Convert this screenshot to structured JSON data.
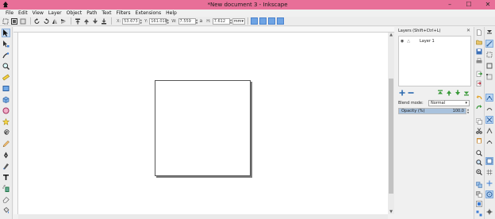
{
  "window": {
    "title": "*New document 3 - Inkscape",
    "controls": {
      "minimize": "–",
      "maximize": "☐",
      "close": "✕"
    },
    "title_bar_color": "#e86f98"
  },
  "menu": [
    "File",
    "Edit",
    "View",
    "Layer",
    "Object",
    "Path",
    "Text",
    "Filters",
    "Extensions",
    "Help"
  ],
  "selector_toolbar": {
    "x_label": "X:",
    "x_value": "53.673",
    "y_label": "Y:",
    "y_value": "161.018",
    "w_label": "W:",
    "w_value": "7.559",
    "lock_icon": "a",
    "h_label": "H:",
    "h_value": "7.612",
    "unit": "mm"
  },
  "layers_panel": {
    "title": "Layers (Shift+Ctrl+L)",
    "layers": [
      {
        "name": "Layer 1",
        "visible": true,
        "locked": false
      }
    ],
    "blend_label": "Blend mode:",
    "blend_value": "Normal",
    "opacity_label": "Opacity (%)",
    "opacity_value": "100.0",
    "opacity_fraction": 1.0
  },
  "icons": {
    "app": "inkscape-logo-icon",
    "tools": [
      "selector-tool-icon",
      "node-tool-icon",
      "tweak-tool-icon",
      "zoom-tool-icon",
      "measure-tool-icon",
      "rectangle-tool-icon",
      "3d-box-tool-icon",
      "ellipse-tool-icon",
      "star-tool-icon",
      "spiral-tool-icon",
      "pencil-tool-icon",
      "pen-tool-icon",
      "calligraphy-tool-icon",
      "text-tool-icon",
      "spray-tool-icon",
      "eraser-tool-icon",
      "paint-bucket-tool-icon"
    ]
  },
  "colors": {
    "accent": "#6fa4e4",
    "selection_highlight": "#bcd6f2"
  }
}
